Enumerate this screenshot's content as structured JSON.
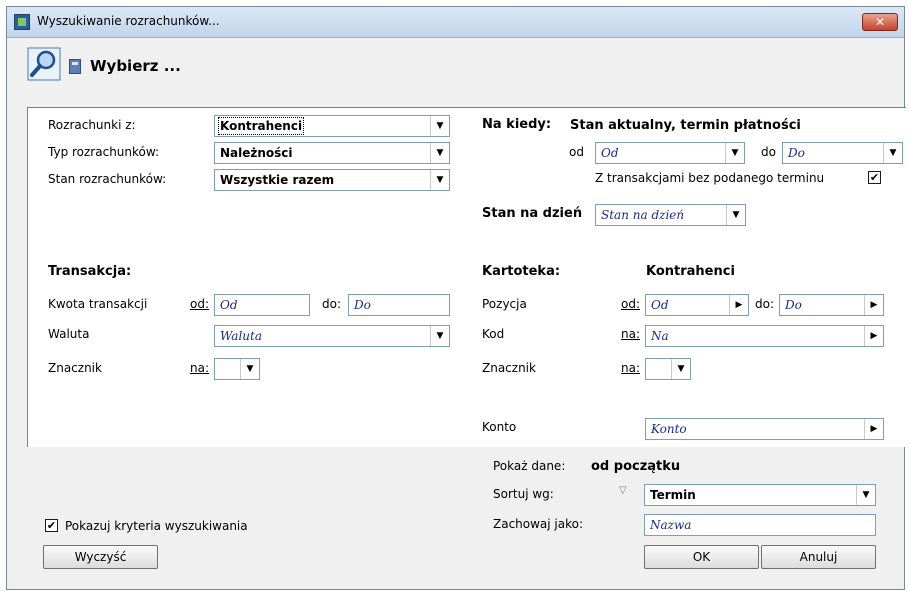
{
  "window": {
    "title": "Wyszukiwanie rozrachunków...",
    "close_label": "✕"
  },
  "header": {
    "title": "Wybierz ..."
  },
  "left": {
    "rozrachunki_z": {
      "label": "Rozrachunki z:",
      "value": "Kontrahenci"
    },
    "typ": {
      "label": "Typ rozrachunków:",
      "value": "Należności"
    },
    "stan": {
      "label": "Stan rozrachunków:",
      "value": "Wszystkie razem"
    },
    "transakcja_title": "Transakcja:",
    "kwota": {
      "label": "Kwota transakcji",
      "od_label": "od:",
      "od_value": "Od",
      "do_label": "do:",
      "do_value": "Do"
    },
    "waluta": {
      "label": "Waluta",
      "value": "Waluta"
    },
    "znacznik": {
      "label": "Znacznik",
      "na_label": "na:",
      "value": ""
    }
  },
  "right": {
    "na_kiedy": {
      "label": "Na kiedy:",
      "value": "Stan aktualny, termin płatności"
    },
    "od_do": {
      "od_label": "od",
      "od_value": "Od",
      "do_label": "do",
      "do_value": "Do"
    },
    "bez_terminu": {
      "label": "Z transakcjami bez podanego terminu",
      "checked": true
    },
    "stan_na_dzien": {
      "label": "Stan na dzień",
      "value": "Stan na dzień"
    },
    "kartoteka": {
      "label": "Kartoteka:",
      "value": "Kontrahenci"
    },
    "pozycja": {
      "label": "Pozycja",
      "od_label": "od:",
      "od_value": "Od",
      "do_label": "do:",
      "do_value": "Do"
    },
    "kod": {
      "label": "Kod",
      "na_label": "na:",
      "value": "Na"
    },
    "znacznik": {
      "label": "Znacznik",
      "na_label": "na:",
      "value": ""
    },
    "konto": {
      "label": "Konto",
      "value": "Konto"
    }
  },
  "footer": {
    "pokaz_dane": {
      "label": "Pokaż dane:",
      "value": "od początku"
    },
    "sortuj": {
      "label": "Sortuj wg:",
      "value": "Termin"
    },
    "zachowaj": {
      "label": "Zachowaj jako:",
      "value": "Nazwa"
    },
    "pokazuj_kryteria": {
      "label": "Pokazuj kryteria wyszukiwania",
      "checked": true
    },
    "wyczysc": "Wyczyść",
    "ok": "OK",
    "anuluj": "Anuluj"
  }
}
